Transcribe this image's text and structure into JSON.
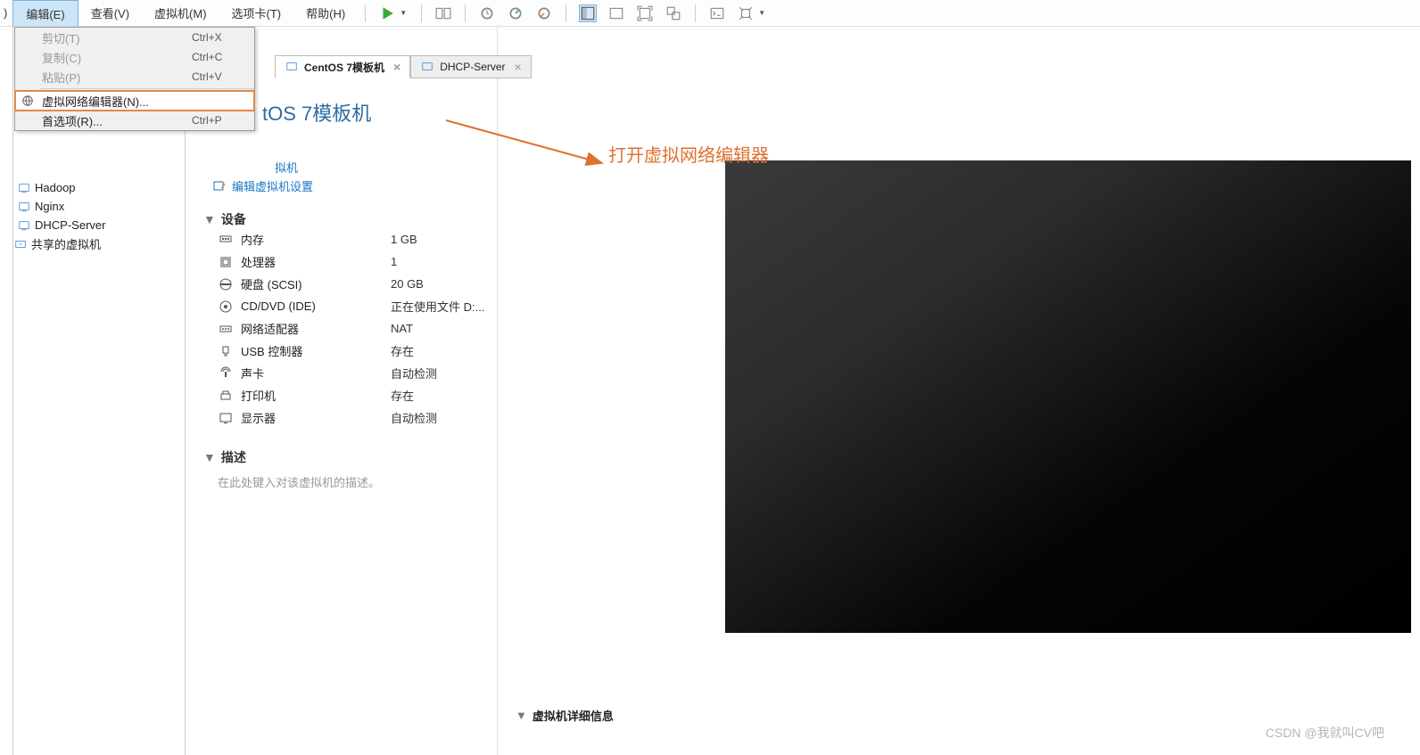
{
  "menubar": {
    "file_frag": ")",
    "edit": "编辑(E)",
    "view": "查看(V)",
    "vm": "虚拟机(M)",
    "tabs": "选项卡(T)",
    "help": "帮助(H)"
  },
  "dropdown": {
    "cut": "剪切(T)",
    "cut_sc": "Ctrl+X",
    "copy": "复制(C)",
    "copy_sc": "Ctrl+C",
    "paste": "粘贴(P)",
    "paste_sc": "Ctrl+V",
    "vnet": "虚拟网络编辑器(N)...",
    "prefs": "首选项(R)...",
    "prefs_sc": "Ctrl+P"
  },
  "sidebar": {
    "partial": "拟机",
    "items": [
      "Hadoop",
      "Nginx",
      "DHCP-Server"
    ],
    "shared": "共享的虚拟机"
  },
  "tabs": {
    "t0": "CentOS 7模板机",
    "t1": "DHCP-Server"
  },
  "vm": {
    "title_frag": "tOS 7模板机",
    "edit_settings": "编辑虚拟机设置",
    "dev_hdr": "设备",
    "devices": [
      {
        "k": "内存",
        "v": "1 GB"
      },
      {
        "k": "处理器",
        "v": "1"
      },
      {
        "k": "硬盘 (SCSI)",
        "v": "20 GB"
      },
      {
        "k": "CD/DVD (IDE)",
        "v": "正在使用文件 D:..."
      },
      {
        "k": "网络适配器",
        "v": "NAT"
      },
      {
        "k": "USB 控制器",
        "v": "存在"
      },
      {
        "k": "声卡",
        "v": "自动检测"
      },
      {
        "k": "打印机",
        "v": "存在"
      },
      {
        "k": "显示器",
        "v": "自动检测"
      }
    ],
    "desc_hdr": "描述",
    "desc_ph": "在此处键入对该虚拟机的描述。",
    "details_hdr": "虚拟机详细信息"
  },
  "annotation": "打开虚拟网络编辑器",
  "watermark": "CSDN @我就叫CV吧"
}
